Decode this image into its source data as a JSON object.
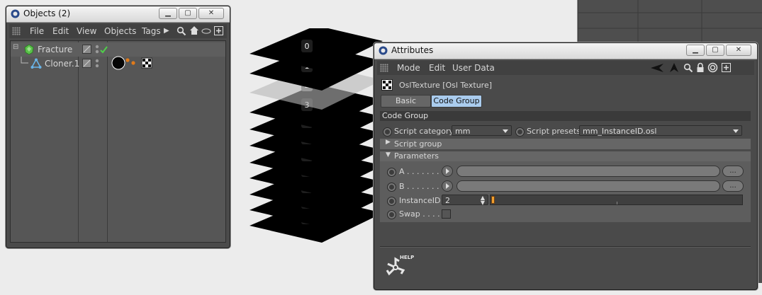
{
  "objects_window": {
    "title": "Objects (2)",
    "menu": [
      "File",
      "Edit",
      "View",
      "Objects",
      "Tags"
    ],
    "tree": [
      {
        "name": "Fracture"
      },
      {
        "name": "Cloner.1"
      }
    ]
  },
  "viewport": {
    "slice_labels": [
      "0",
      "1",
      "2",
      "3",
      "4",
      "5",
      "6",
      "7",
      "8",
      "9",
      "10"
    ]
  },
  "attributes_window": {
    "title": "Attributes",
    "menu": [
      "Mode",
      "Edit",
      "User Data"
    ],
    "object_name": "OslTexture [Osl Texture]",
    "tabs": [
      {
        "label": "Basic",
        "active": false
      },
      {
        "label": "Code Group",
        "active": true
      }
    ],
    "section_title": "Code Group",
    "script_category_label": "Script category",
    "script_category_value": "mm",
    "script_presets_label": "Script presets",
    "script_presets_value": "mm_InstanceID.osl",
    "script_group_label": "Script group",
    "parameters_label": "Parameters",
    "param_a_label": "A . . . . . . . .",
    "param_b_label": "B . . . . . . . .",
    "ellipsis": "...",
    "instance_id_label": "InstanceID",
    "instance_id_value": "2",
    "swap_label": "Swap . . . . .",
    "help_label": "HELP"
  },
  "colors": {
    "accent_tab": "#aaccee",
    "window_bg": "#4a4a4a",
    "panel_bg": "#5d5d5d",
    "slider_marker": "#f0a030"
  }
}
